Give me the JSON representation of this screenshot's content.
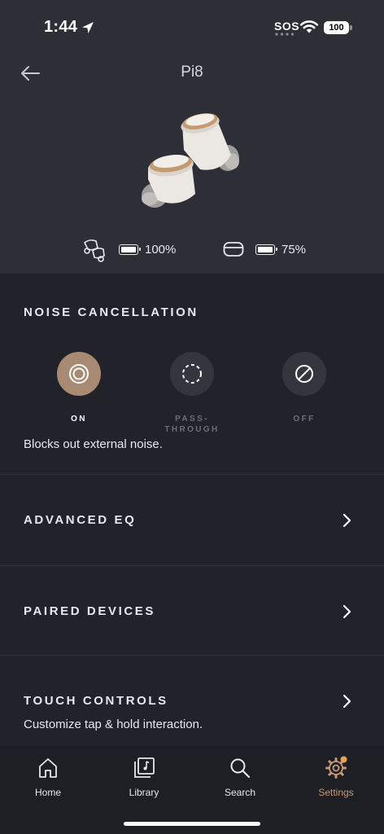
{
  "status_bar": {
    "time": "1:44",
    "sos": "SOS",
    "battery": "100"
  },
  "header": {
    "title": "Pi8"
  },
  "device": {
    "earbuds_battery": "100%",
    "case_battery": "75%"
  },
  "noise_cancellation": {
    "title": "NOISE CANCELLATION",
    "options": [
      {
        "label": "ON",
        "selected": true
      },
      {
        "label_line1": "PASS-",
        "label_line2": "THROUGH",
        "selected": false
      },
      {
        "label": "OFF",
        "selected": false
      }
    ],
    "description": "Blocks out external noise."
  },
  "settings_rows": [
    {
      "label": "ADVANCED EQ"
    },
    {
      "label": "PAIRED DEVICES"
    },
    {
      "label": "TOUCH CONTROLS",
      "subtitle": "Customize tap & hold interaction."
    }
  ],
  "tabbar": {
    "tabs": [
      {
        "label": "Home",
        "icon": "home-icon"
      },
      {
        "label": "Library",
        "icon": "library-icon"
      },
      {
        "label": "Search",
        "icon": "search-icon"
      },
      {
        "label": "Settings",
        "icon": "gear-icon",
        "active": true
      }
    ]
  },
  "colors": {
    "accent": "#a88a72",
    "accent_text": "#c59a74",
    "background": "#22232a",
    "header_bg": "#2e2f36"
  }
}
